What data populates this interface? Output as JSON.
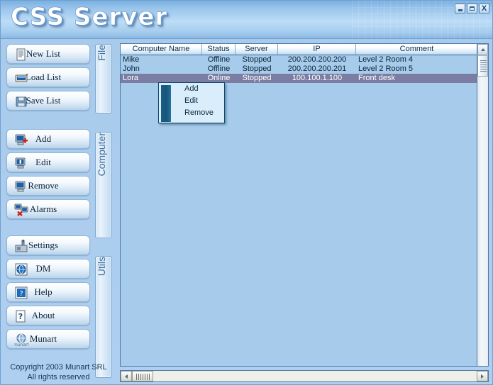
{
  "window": {
    "title": "CSS Server",
    "buttons": [
      {
        "name": "minimize-button",
        "label": "_"
      },
      {
        "name": "maximize-button",
        "label": "□"
      },
      {
        "name": "close-button",
        "label": "X"
      }
    ]
  },
  "sidebar": {
    "groups": [
      {
        "tab_label": "File",
        "buttons": [
          {
            "icon": "document-lines-icon",
            "label": "New List"
          },
          {
            "icon": "folder-open-icon",
            "label": "Load List"
          },
          {
            "icon": "floppy-disk-icon",
            "label": "Save List"
          }
        ]
      },
      {
        "tab_label": "Computer",
        "buttons": [
          {
            "icon": "computer-add-icon",
            "label": "Add"
          },
          {
            "icon": "computer-edit-icon",
            "label": "Edit"
          },
          {
            "icon": "computer-remove-icon",
            "label": "Remove"
          },
          {
            "icon": "computer-alarm-icon",
            "label": "Alarms"
          }
        ]
      },
      {
        "tab_label": "Utils",
        "buttons": [
          {
            "icon": "tools-settings-icon",
            "label": "Settings"
          },
          {
            "icon": "globe-icon",
            "label": "DM"
          },
          {
            "icon": "help-arrow-icon",
            "label": "Help"
          },
          {
            "icon": "question-mark-icon",
            "label": "About"
          },
          {
            "icon": "munart-globe-icon",
            "label": "Munart"
          }
        ]
      }
    ],
    "copyright_line1": "Copyright 2003 Munart SRL",
    "copyright_line2": "All rights reserved"
  },
  "list": {
    "columns": [
      {
        "key": "name",
        "label": "Computer Name"
      },
      {
        "key": "status",
        "label": "Status"
      },
      {
        "key": "server",
        "label": "Server"
      },
      {
        "key": "ip",
        "label": "IP"
      },
      {
        "key": "comment",
        "label": "Comment"
      }
    ],
    "rows": [
      {
        "name": "Mike",
        "status": "Offline",
        "server": "Stopped",
        "ip": "200.200.200.200",
        "comment": "Level 2 Room 4",
        "selected": false
      },
      {
        "name": "John",
        "status": "Offline",
        "server": "Stopped",
        "ip": "200.200.200.201",
        "comment": "Level 2 Room 5",
        "selected": false
      },
      {
        "name": "Lora",
        "status": "Online",
        "server": "Stopped",
        "ip": "100.100.1.100",
        "comment": "Front desk",
        "selected": true
      }
    ]
  },
  "context_menu": {
    "items": [
      {
        "label": "Add"
      },
      {
        "label": "Edit"
      },
      {
        "label": "Remove"
      }
    ]
  },
  "colors": {
    "window_bg": "#aecff0",
    "titlebar_light": "#bcdcf7",
    "list_bg": "#a7cbea",
    "selected_row": "#7b7ea2",
    "accent_border": "#4a79a8",
    "menu_stripe": "#1c5d85",
    "menu_bg": "#d9eefa"
  }
}
